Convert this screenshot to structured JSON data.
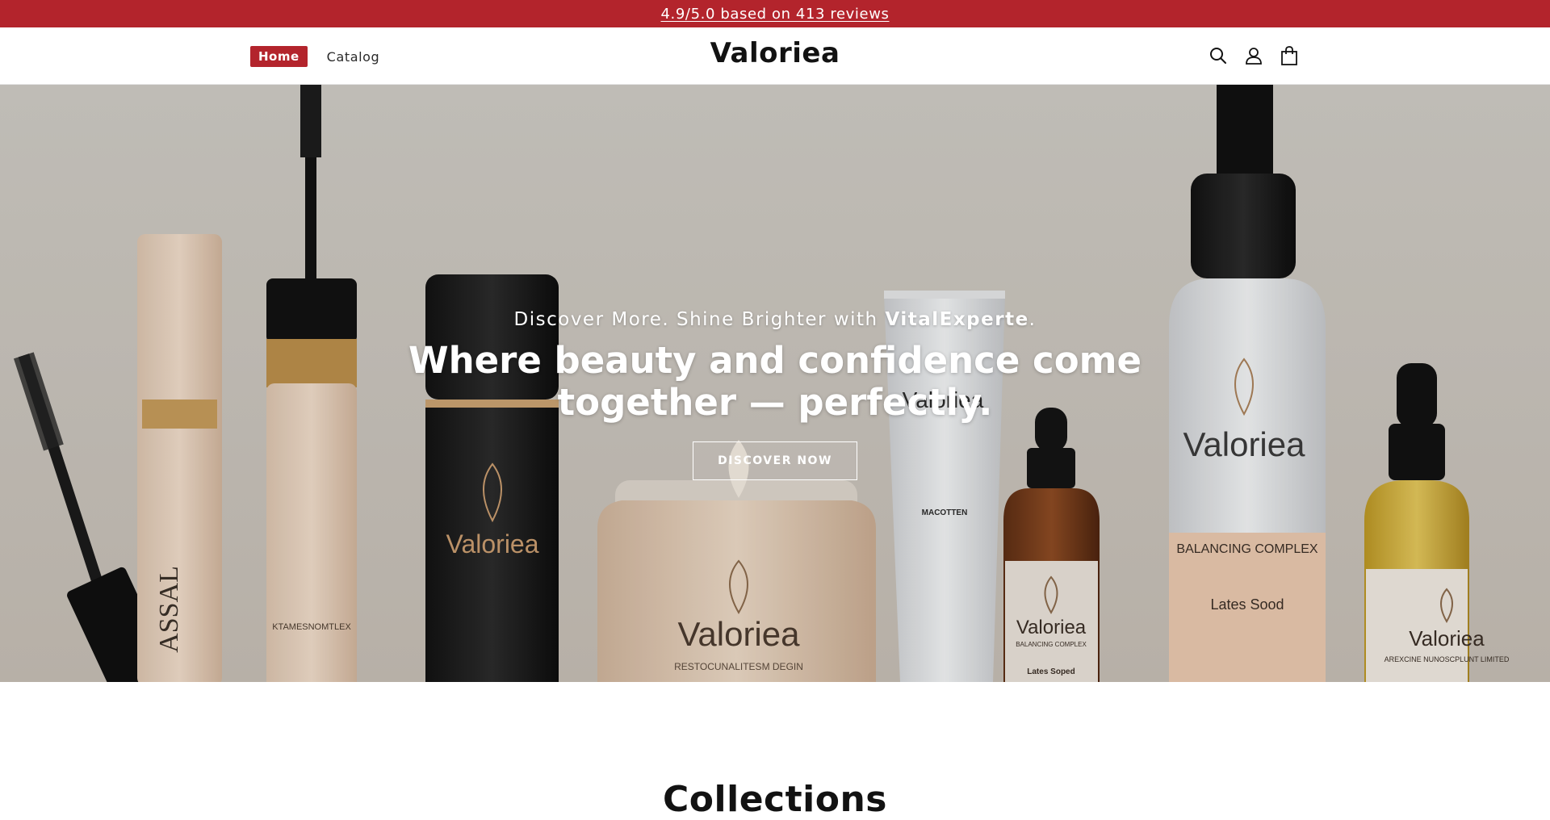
{
  "announcement": {
    "text": "4.9/5.0 based on 413 reviews"
  },
  "nav": {
    "home_label": "Home",
    "catalog_label": "Catalog"
  },
  "brand": {
    "name": "Valoriea"
  },
  "header_icons": [
    "search-icon",
    "account-icon",
    "cart-icon"
  ],
  "hero": {
    "tagline_prefix": "Discover More. Shine Brighter with ",
    "tagline_brand": "VitalExperte",
    "tagline_suffix": ".",
    "headline": "Where beauty and confidence come together — perfectly.",
    "cta_label": "DISCOVER NOW",
    "product_labels": {
      "mascara_tube": "ASSAL",
      "foundation_bottle": "KTAMESNOMTLEX",
      "dark_bottle": "Valoriea",
      "jar": "Valoriea",
      "jar_sub": "RESTOCUNALITESM DEGIN",
      "tube": "Valoriea",
      "tube_sub": "MACOTTEN",
      "serum_small": "Valoriea",
      "serum_small_sub": "BALANCING COMPLEX",
      "serum_small_sub2": "Lates Soped",
      "spray": "Valoriea",
      "spray_title": "BALANCING COMPLEX",
      "spray_sub": "Lates Sood",
      "dropper_right": "Valoriea",
      "dropper_right_sub": "AREXCINE NUNOSCPLUNT LIMITED"
    }
  },
  "sections": {
    "collections_title": "Collections"
  },
  "colors": {
    "accent": "#b3242c",
    "text": "#121212"
  }
}
